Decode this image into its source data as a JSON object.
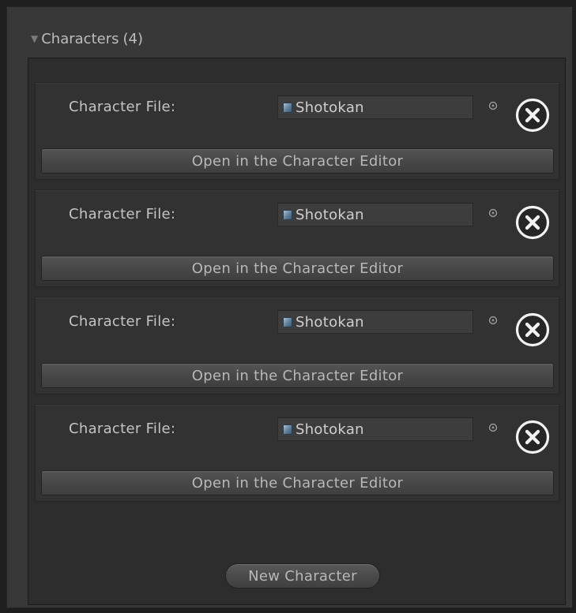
{
  "foldout": {
    "title": "Characters",
    "count": "(4)",
    "expanded": true
  },
  "characters": [
    {
      "label": "Character File:",
      "value": "Shotokan",
      "open_label": "Open in the Character Editor"
    },
    {
      "label": "Character File:",
      "value": "Shotokan",
      "open_label": "Open in the Character Editor"
    },
    {
      "label": "Character File:",
      "value": "Shotokan",
      "open_label": "Open in the Character Editor"
    },
    {
      "label": "Character File:",
      "value": "Shotokan",
      "open_label": "Open in the Character Editor"
    }
  ],
  "new_character_label": "New Character",
  "icons": {
    "foldout_arrow": "triangle-down-icon",
    "object_field": "scriptable-object-icon",
    "picker": "object-picker-icon",
    "remove": "close-circle-icon"
  },
  "colors": {
    "background": "#383838",
    "panel": "#2d2d2d",
    "entry": "#323232",
    "text": "#c4c4c4"
  }
}
